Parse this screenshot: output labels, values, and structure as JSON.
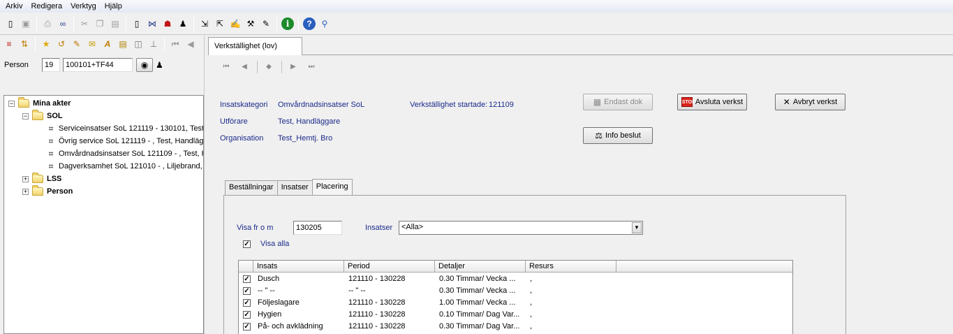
{
  "menu": [
    "Arkiv",
    "Redigera",
    "Verktyg",
    "Hjälp"
  ],
  "toolbar_icons": [
    "new-doc-icon",
    "save-icon",
    "print-icon",
    "find-icon",
    "cut-icon",
    "copy-icon",
    "paste-icon",
    "page-icon",
    "tree-icon",
    "people-icon",
    "person-icon",
    "export-icon",
    "import-icon",
    "sign-icon",
    "tools-icon",
    "edit-icon",
    "info-icon",
    "help-icon",
    "search-help-icon"
  ],
  "left_toolbar_icons": [
    "list-icon",
    "sort-icon",
    "star-icon",
    "undo-icon",
    "note-icon",
    "mail-icon",
    "text-icon",
    "doc-icon",
    "book-icon",
    "stamp-icon",
    "first-icon",
    "prev-icon"
  ],
  "person": {
    "label": "Person",
    "year": "19",
    "id": "100101+TF44"
  },
  "tree": {
    "root": "Mina akter",
    "sol": "SOL",
    "sol_items": [
      "Serviceinsatser SoL 121119 - 130101, Test",
      "Övrig service SoL 121119 - , Test, Handlägg",
      "Omvårdnadsinsatser SoL 121109 - , Test, H",
      "Dagverksamhet SoL 121010 - , Liljebrand, A"
    ],
    "lss": "LSS",
    "person": "Person"
  },
  "doc_tab": "Verkställighet (lov)",
  "info": {
    "insatskategori_label": "Insatskategori",
    "insatskategori_value": "Omvårdnadsinsatser SoL",
    "started_label": "Verkställighet startade:",
    "started_value": "121109",
    "utforare_label": "Utförare",
    "utforare_value": "Test, Handläggare",
    "organisation_label": "Organisation",
    "organisation_value": "Test_Hemtj. Bro"
  },
  "buttons": {
    "endast_dok": "Endast dok",
    "avsluta": "Avsluta verkst",
    "avbryt": "Avbryt verkst",
    "info_beslut": "Info beslut",
    "stop_badge": "STOP"
  },
  "inner_tabs": [
    "Beställningar",
    "Insatser",
    "Placering"
  ],
  "filters": {
    "visa_label": "Visa fr o m",
    "visa_value": "130205",
    "insatser_label": "Insatser",
    "insatser_value": "<Alla>",
    "visa_alla": "Visa alla"
  },
  "grid": {
    "columns": [
      "Insats",
      "Period",
      "Detaljer",
      "Resurs"
    ],
    "rows": [
      {
        "insats": "Dusch",
        "period": "121110 - 130228",
        "detaljer": "0.30 Timmar/ Vecka  ...",
        "resurs": ","
      },
      {
        "insats": "-- \" --",
        "period": "-- \" --",
        "detaljer": "0.30 Timmar/ Vecka  ...",
        "resurs": ","
      },
      {
        "insats": "Följeslagare",
        "period": "121110 - 130228",
        "detaljer": "1.00 Timmar/ Vecka  ...",
        "resurs": ","
      },
      {
        "insats": "Hygien",
        "period": "121110 - 130228",
        "detaljer": "0.10 Timmar/ Dag  Var...",
        "resurs": ","
      },
      {
        "insats": "På- och avklädning",
        "period": "121110 - 130228",
        "detaljer": "0.30 Timmar/ Dag  Var...",
        "resurs": ","
      }
    ]
  }
}
